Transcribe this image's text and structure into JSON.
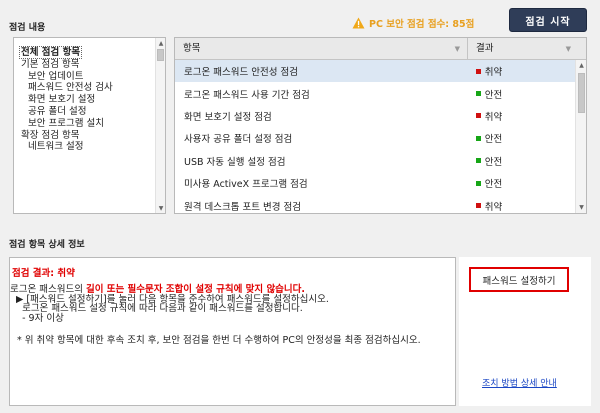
{
  "inspection_section_title": "점검 내용",
  "warning_text": "PC 보안 점검 점수: 85점",
  "start_button_label": "점검 시작",
  "tree": {
    "items": [
      {
        "label": "전체 점검 항목",
        "level": 0,
        "selected": true
      },
      {
        "label": "기본 점검 항목",
        "level": 1,
        "selected": false
      },
      {
        "label": "보안 업데이트",
        "level": 2,
        "selected": false
      },
      {
        "label": "패스워드 안전성 검사",
        "level": 2,
        "selected": false
      },
      {
        "label": "화면 보호기 설정",
        "level": 2,
        "selected": false
      },
      {
        "label": "공유 폴더 설정",
        "level": 2,
        "selected": false
      },
      {
        "label": "보안 프로그램 설치",
        "level": 2,
        "selected": false
      },
      {
        "label": "확장 점검 항목",
        "level": 1,
        "selected": false
      },
      {
        "label": "네트워크 설정",
        "level": 2,
        "selected": false
      }
    ]
  },
  "table": {
    "col_name": "항목",
    "col_result": "결과",
    "rows": [
      {
        "name": "로그온 패스워드 안전성 점검",
        "result": "취약",
        "status_color": "#d01010",
        "selected": true
      },
      {
        "name": "로그온 패스워드 사용 기간 점검",
        "result": "안전",
        "status_color": "#16a616",
        "selected": false
      },
      {
        "name": "화면 보호기 설정 점검",
        "result": "취약",
        "status_color": "#d01010",
        "selected": false
      },
      {
        "name": "사용자 공유 폴더 설정 점검",
        "result": "안전",
        "status_color": "#16a616",
        "selected": false
      },
      {
        "name": "USB 자동 실행 설정 점검",
        "result": "안전",
        "status_color": "#16a616",
        "selected": false
      },
      {
        "name": "미사용 ActiveX 프로그램 점검",
        "result": "안전",
        "status_color": "#16a616",
        "selected": false
      },
      {
        "name": "원격 데스크톱 포트 변경 점검",
        "result": "취약",
        "status_color": "#d01010",
        "selected": false
      }
    ]
  },
  "detail_section_title": "점검 항목 상세 정보",
  "detail": {
    "result_line": "점검 결과: 취약",
    "line1_prefix": "로그온 패스워드의 ",
    "line1_red": "길이 또는 필수문자 조합이 설정 규칙에 맞지 않습니다.",
    "line2": "  ▶ [패스워드 설정하기]를 눌러 다음 항목을 준수하여 패스워드를 설정하십시오.",
    "line3": "    로그온 패스워드 설정 규칙에 따라 다음과 같이 패스워드를 설정합니다.",
    "line4": "    - 9자 이상",
    "note": "* 위 취약 항목에 대한 후속 조치 후, 보안 점검을 한번 더 수행하여 PC의 안정성을 최종 점검하십시오."
  },
  "password_button_label": "패스워드 설정하기",
  "guide_link_label": "조치 방법 상세 안내"
}
